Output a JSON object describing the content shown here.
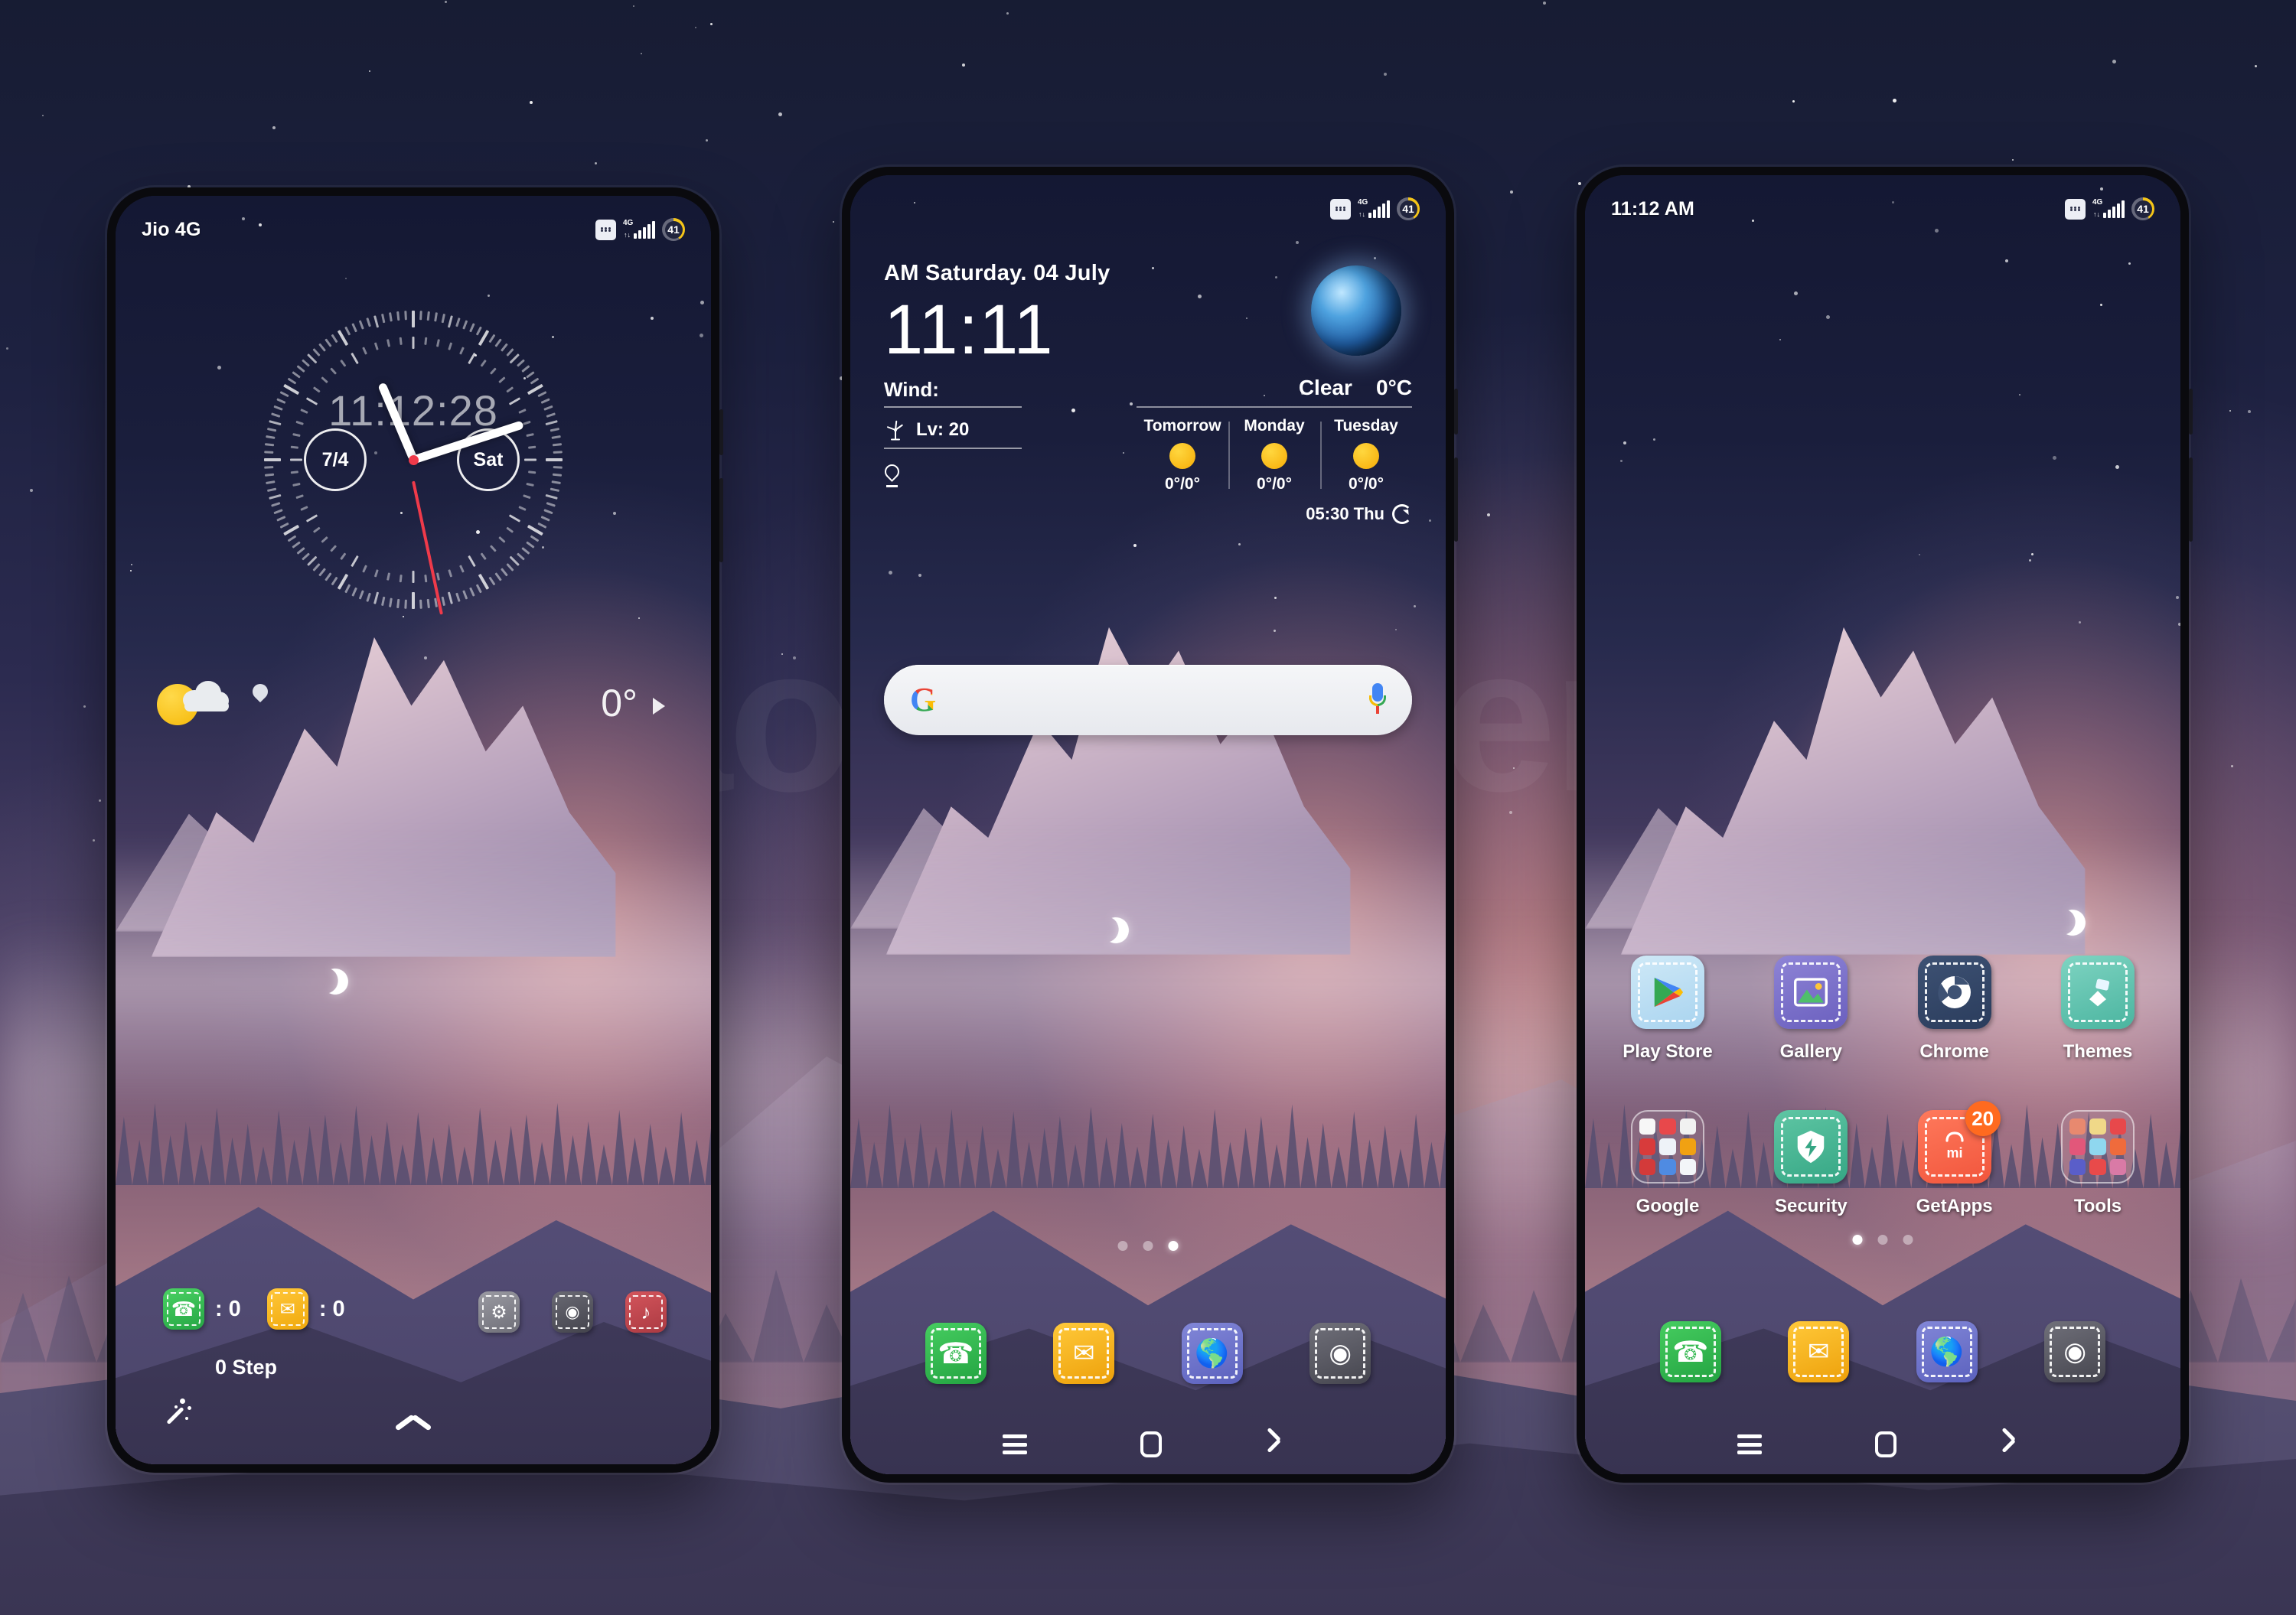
{
  "watermark": "xiaomiuitheme",
  "phones": [
    {
      "id": "lockscreen",
      "statusbar": {
        "left": "Jio 4G",
        "network": "4G",
        "battery": "41"
      },
      "clock": {
        "digital_time": "11:12:28",
        "date_circle": "7/4",
        "day_circle": "Sat"
      },
      "weather": {
        "temp": "0",
        "degree": "°"
      },
      "shortcuts": {
        "calls_label": ":",
        "calls_count": "0",
        "messages_label": ":",
        "messages_count": "0"
      },
      "steps": "0 Step",
      "right_shortcuts": [
        "settings-shortcut",
        "camera-shortcut",
        "music-shortcut"
      ]
    },
    {
      "id": "home-search",
      "statusbar": {
        "left": "",
        "network": "4G",
        "battery": "41"
      },
      "widget": {
        "date": "AM Saturday. 04 July",
        "time": "11:11",
        "wind_label": "Wind:",
        "wind_level": "Lv: 20",
        "condition": "Clear",
        "temperature": "0°C",
        "forecast": [
          {
            "day": "Tomorrow",
            "icon": "sun-icon",
            "temps": "0°/0°"
          },
          {
            "day": "Monday",
            "icon": "sun-icon",
            "temps": "0°/0°"
          },
          {
            "day": "Tuesday",
            "icon": "sun-icon",
            "temps": "0°/0°"
          }
        ],
        "updated": "05:30 Thu"
      },
      "search": {
        "placeholder": "",
        "value": ""
      },
      "pager": {
        "count": 3,
        "active": 2
      },
      "dock": [
        "Phone",
        "Messages",
        "Browser",
        "Camera"
      ],
      "navbar": [
        "recents",
        "home",
        "back"
      ]
    },
    {
      "id": "home-apps",
      "statusbar": {
        "left": "11:12 AM",
        "network": "4G",
        "battery": "41"
      },
      "apps_row1": [
        {
          "label": "Play Store",
          "icon": "play-store-icon"
        },
        {
          "label": "Gallery",
          "icon": "gallery-icon"
        },
        {
          "label": "Chrome",
          "icon": "chrome-icon"
        },
        {
          "label": "Themes",
          "icon": "themes-icon"
        }
      ],
      "apps_row2": [
        {
          "label": "Google",
          "icon": "google-folder-icon",
          "badge": ""
        },
        {
          "label": "Security",
          "icon": "security-icon",
          "badge": ""
        },
        {
          "label": "GetApps",
          "icon": "getapps-icon",
          "badge": "20"
        },
        {
          "label": "Tools",
          "icon": "tools-folder-icon",
          "badge": ""
        }
      ],
      "pager": {
        "count": 3,
        "active": 0
      },
      "dock": [
        "Phone",
        "Messages",
        "Browser",
        "Camera"
      ],
      "navbar": [
        "recents",
        "home",
        "back"
      ]
    }
  ],
  "colors": {
    "accent_green": "#31b94d",
    "accent_yellow": "#f0a90c",
    "accent_blue": "#6f74c9",
    "accent_grey": "#5d5d66",
    "accent_red": "#c0474d",
    "badge_orange": "#ff6a1f",
    "battery_yellow": "#f5c518",
    "second_hand_red": "#ef3a4a"
  }
}
